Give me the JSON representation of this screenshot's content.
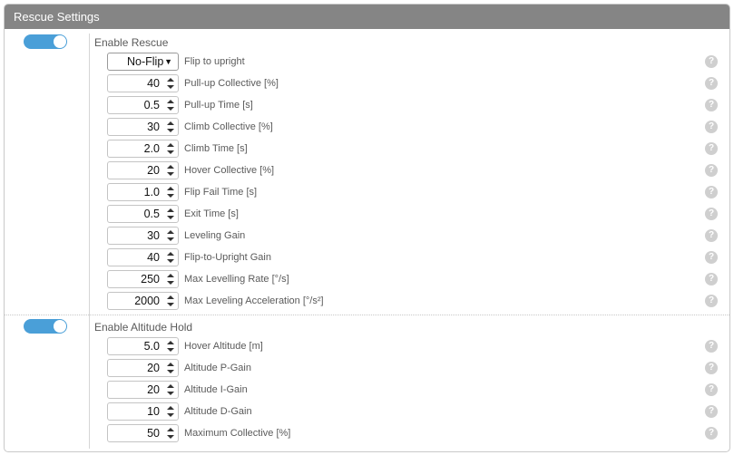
{
  "panel": {
    "title": "Rescue Settings",
    "help_glyph": "?"
  },
  "rescue": {
    "enable_label": "Enable Rescue",
    "enabled": true,
    "flip": {
      "value": "No-Flip",
      "label": "Flip to upright"
    },
    "fields": [
      {
        "value": "40",
        "label": "Pull-up Collective [%]"
      },
      {
        "value": "0.5",
        "label": "Pull-up Time [s]"
      },
      {
        "value": "30",
        "label": "Climb Collective [%]"
      },
      {
        "value": "2.0",
        "label": "Climb Time [s]"
      },
      {
        "value": "20",
        "label": "Hover Collective [%]"
      },
      {
        "value": "1.0",
        "label": "Flip Fail Time [s]"
      },
      {
        "value": "0.5",
        "label": "Exit Time [s]"
      },
      {
        "value": "30",
        "label": "Leveling Gain"
      },
      {
        "value": "40",
        "label": "Flip-to-Upright Gain"
      },
      {
        "value": "250",
        "label": "Max Levelling Rate [°/s]"
      },
      {
        "value": "2000",
        "label": "Max Leveling Acceleration [°/s²]"
      }
    ]
  },
  "altitude_hold": {
    "enable_label": "Enable Altitude Hold",
    "enabled": true,
    "fields": [
      {
        "value": "5.0",
        "label": "Hover Altitude [m]"
      },
      {
        "value": "20",
        "label": "Altitude P-Gain"
      },
      {
        "value": "20",
        "label": "Altitude I-Gain"
      },
      {
        "value": "10",
        "label": "Altitude D-Gain"
      },
      {
        "value": "50",
        "label": "Maximum Collective [%]"
      }
    ]
  },
  "colors": {
    "header_bg": "#858585",
    "toggle_on": "#4a9fd8",
    "help_icon": "#cfcfcf"
  },
  "icons": {
    "toggle": "toggle-switch",
    "help": "question-circle-icon",
    "spin_up": "triangle-up",
    "spin_down": "triangle-down",
    "select": "chevron-down-icon"
  }
}
